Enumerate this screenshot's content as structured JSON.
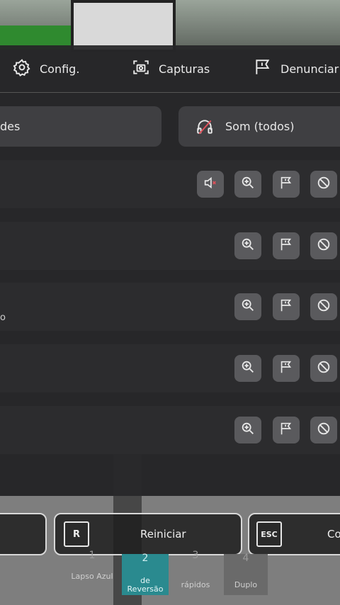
{
  "topbar": {
    "config_label": "Config.",
    "captures_label": "Capturas",
    "report_label": "Denunciar"
  },
  "pills": {
    "left_label": "des",
    "sound_label": "Som (todos)"
  },
  "rows": [
    {
      "label": ""
    },
    {
      "label": ""
    },
    {
      "label": "o"
    },
    {
      "label": ""
    },
    {
      "label": ""
    }
  ],
  "bottom": {
    "restart_key": "R",
    "restart_label": "Reiniciar",
    "esc_key": "ESC",
    "esc_label": "Co"
  },
  "hotbar": [
    {
      "num": "1",
      "label": "Lapso Azul"
    },
    {
      "num": "2",
      "label": "de Reversão"
    },
    {
      "num": "3",
      "label": "rápidos"
    },
    {
      "num": "4",
      "label": "Duplo"
    }
  ],
  "icons": {
    "mute": "speaker-muted-icon",
    "zoom": "zoom-in-icon",
    "report": "flag-icon",
    "block": "block-icon"
  },
  "colors": {
    "mute_accent": "#e0505a",
    "selected_slot": "#2a8a8f"
  }
}
